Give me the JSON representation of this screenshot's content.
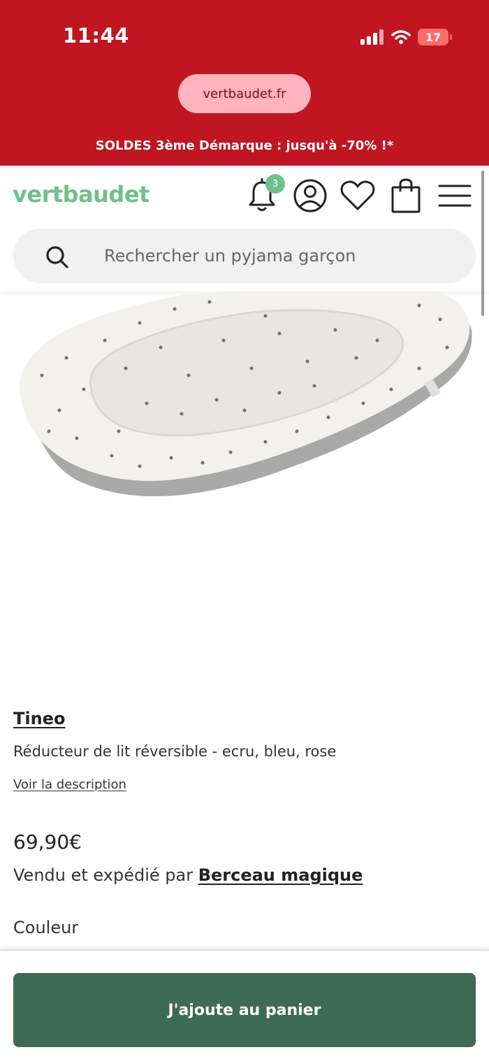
{
  "status_bar": {
    "time": "11:44",
    "battery": "17"
  },
  "browser": {
    "url": "vertbaudet.fr"
  },
  "promo_banner": {
    "text": "SOLDES 3ème Démarque : jusqu'à -70% !*"
  },
  "header": {
    "logo": "vertbaudet",
    "notification_count": "3",
    "icons": [
      "bell-icon",
      "account-icon",
      "heart-icon",
      "shopping-bag-icon",
      "menu-icon"
    ]
  },
  "search": {
    "placeholder": "Rechercher un pyjama garçon"
  },
  "product": {
    "brand": "Tineo",
    "name": "Réducteur de lit réversible - ecru, bleu, rose",
    "description_link": "Voir la description",
    "price": "69,90€",
    "seller_prefix": "Vendu et expédié par",
    "seller_name": "Berceau magique",
    "color_label": "Couleur"
  },
  "actions": {
    "add_to_cart": "J'ajoute au panier"
  },
  "colors": {
    "brand_red": "#bf1622",
    "logo_green": "#6fc08b",
    "cart_green": "#3e6b53"
  }
}
